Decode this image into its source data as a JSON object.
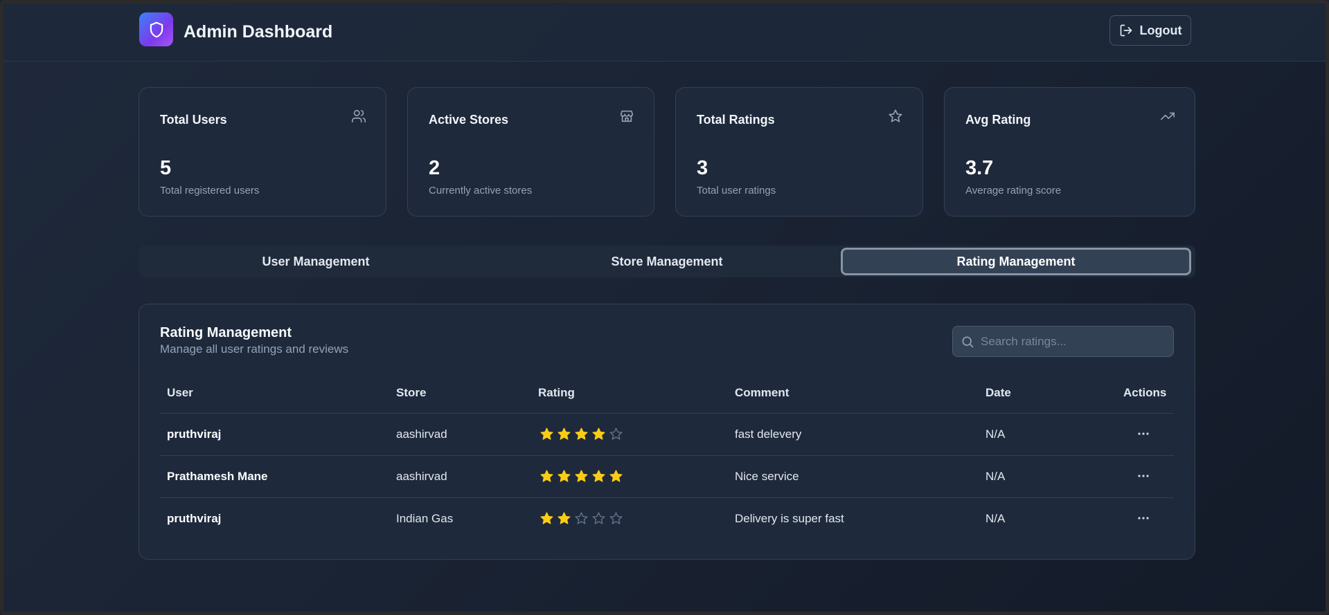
{
  "header": {
    "title": "Admin Dashboard",
    "logout_label": "Logout",
    "logo_icon": "shield-icon"
  },
  "stats": [
    {
      "title": "Total Users",
      "value": "5",
      "subtitle": "Total registered users",
      "icon": "users-icon"
    },
    {
      "title": "Active Stores",
      "value": "2",
      "subtitle": "Currently active stores",
      "icon": "store-icon"
    },
    {
      "title": "Total Ratings",
      "value": "3",
      "subtitle": "Total user ratings",
      "icon": "star-icon"
    },
    {
      "title": "Avg Rating",
      "value": "3.7",
      "subtitle": "Average rating score",
      "icon": "trending-up-icon"
    }
  ],
  "tabs": [
    {
      "label": "User Management",
      "active": false
    },
    {
      "label": "Store Management",
      "active": false
    },
    {
      "label": "Rating Management",
      "active": true
    }
  ],
  "panel": {
    "title": "Rating Management",
    "subtitle": "Manage all user ratings and reviews",
    "search_placeholder": "Search ratings...",
    "search_value": ""
  },
  "table": {
    "headers": [
      "User",
      "Store",
      "Rating",
      "Comment",
      "Date",
      "Actions"
    ],
    "rows": [
      {
        "user": "pruthviraj",
        "store": "aashirvad",
        "rating": 4,
        "comment": "fast delevery",
        "date": "N/A"
      },
      {
        "user": "Prathamesh Mane",
        "store": "aashirvad",
        "rating": 5,
        "comment": "Nice service",
        "date": "N/A"
      },
      {
        "user": "pruthviraj",
        "store": "Indian Gas",
        "rating": 2,
        "comment": "Delivery is super fast",
        "date": "N/A"
      }
    ],
    "max_rating": 5
  },
  "colors": {
    "star_filled": "#facc15",
    "star_empty": "#64748b",
    "accent_gradient_start": "#3b82f6",
    "accent_gradient_end": "#a855f7"
  }
}
